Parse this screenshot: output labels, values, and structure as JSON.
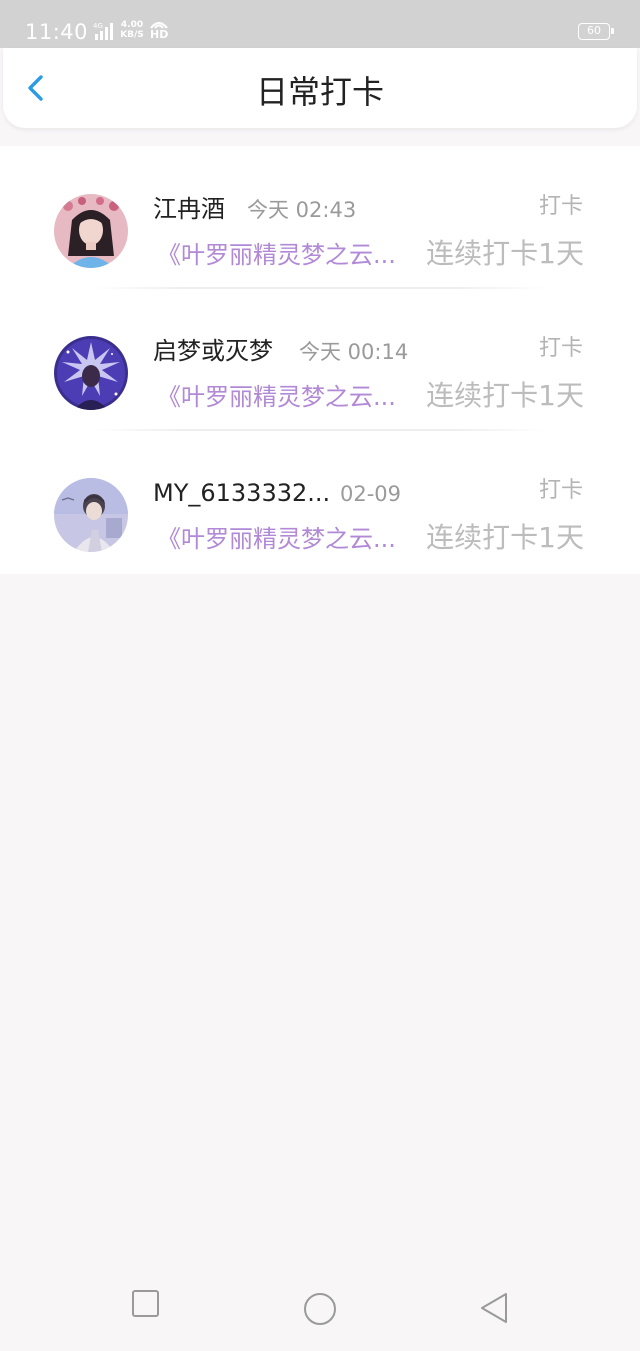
{
  "status_bar": {
    "time": "11:40",
    "network": "4G",
    "speed_value": "4.00",
    "speed_unit": "KB/S",
    "hd": "HD",
    "battery": "60"
  },
  "header": {
    "title": "日常打卡",
    "back_icon": "chevron-left-icon",
    "accent_color": "#2b9be6"
  },
  "items": [
    {
      "name": "江冉酒",
      "time": "今天 02:43",
      "action": "打卡",
      "book": "《叶罗丽精灵梦之云...",
      "streak": "连续打卡1天"
    },
    {
      "name": "启梦或灭梦",
      "time": "今天 00:14",
      "action": "打卡",
      "book": "《叶罗丽精灵梦之云...",
      "streak": "连续打卡1天"
    },
    {
      "name": "MY_6133332...",
      "time": "02-09",
      "action": "打卡",
      "book": "《叶罗丽精灵梦之云...",
      "streak": "连续打卡1天"
    }
  ],
  "colors": {
    "book_title": "#b189d6",
    "muted_text": "#bcbcbc",
    "background": "#f8f6f7"
  },
  "nav": {
    "icons": [
      "square-recents-icon",
      "circle-home-icon",
      "triangle-back-icon"
    ]
  }
}
